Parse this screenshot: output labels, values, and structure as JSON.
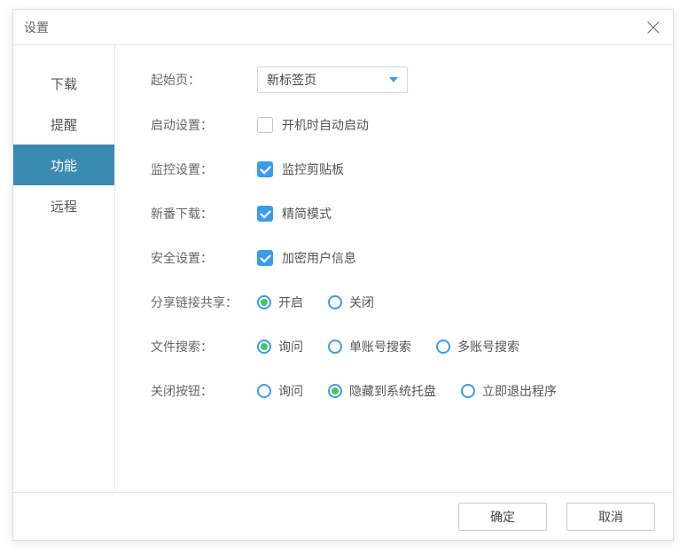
{
  "dialog": {
    "title": "设置"
  },
  "sidebar": {
    "items": [
      {
        "label": "下载",
        "active": false
      },
      {
        "label": "提醒",
        "active": false
      },
      {
        "label": "功能",
        "active": true
      },
      {
        "label": "远程",
        "active": false
      }
    ]
  },
  "form": {
    "startPage": {
      "label": "起始页：",
      "value": "新标签页"
    },
    "startupSetting": {
      "label": "启动设置：",
      "checkboxLabel": "开机时自动启动",
      "checked": false
    },
    "monitorSetting": {
      "label": "监控设置：",
      "checkboxLabel": "监控剪贴板",
      "checked": true
    },
    "newDownload": {
      "label": "新番下载：",
      "checkboxLabel": "精简模式",
      "checked": true
    },
    "securitySetting": {
      "label": "安全设置：",
      "checkboxLabel": "加密用户信息",
      "checked": true
    },
    "shareLink": {
      "label": "分享链接共享：",
      "options": [
        {
          "label": "开启",
          "selected": true
        },
        {
          "label": "关闭",
          "selected": false
        }
      ]
    },
    "fileSearch": {
      "label": "文件搜索：",
      "options": [
        {
          "label": "询问",
          "selected": true
        },
        {
          "label": "单账号搜索",
          "selected": false
        },
        {
          "label": "多账号搜索",
          "selected": false
        }
      ]
    },
    "closeButton": {
      "label": "关闭按钮：",
      "options": [
        {
          "label": "询问",
          "selected": false
        },
        {
          "label": "隐藏到系统托盘",
          "selected": true
        },
        {
          "label": "立即退出程序",
          "selected": false
        }
      ]
    }
  },
  "footer": {
    "confirm": "确定",
    "cancel": "取消"
  }
}
